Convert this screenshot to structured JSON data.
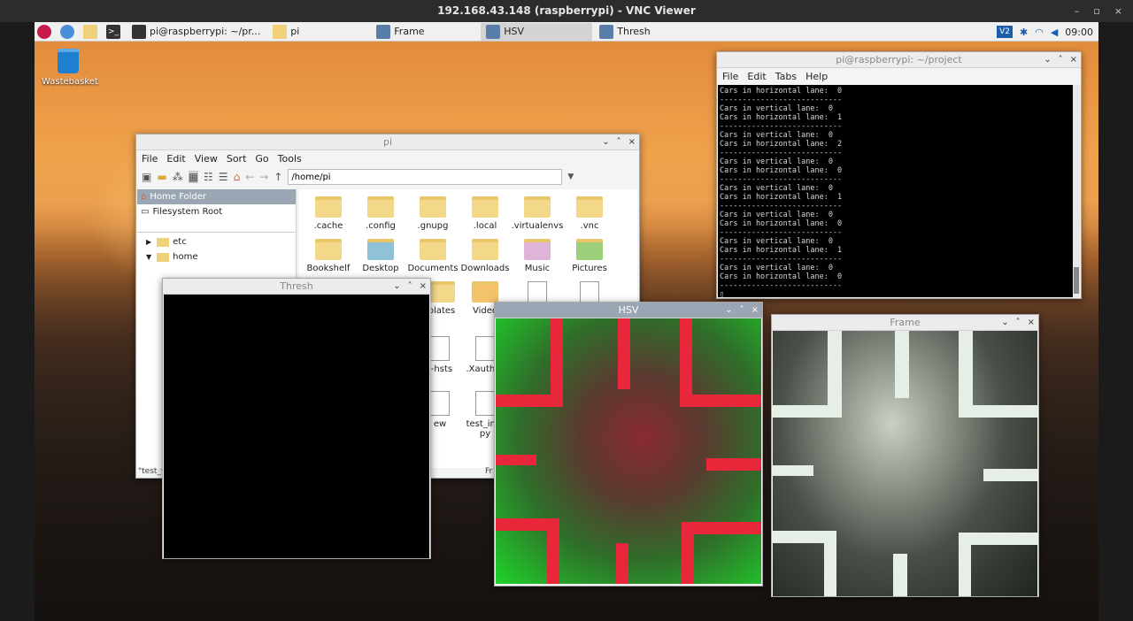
{
  "vnc": {
    "title": "192.168.43.148 (raspberrypi) - VNC Viewer",
    "minimize": "–",
    "restore": "▫",
    "close": "×"
  },
  "panel": {
    "tasks": [
      {
        "label": "pi@raspberrypi: ~/pr..."
      },
      {
        "label": "pi"
      },
      {
        "label": "Frame"
      },
      {
        "label": "HSV"
      },
      {
        "label": "Thresh"
      }
    ],
    "clock": "09:00"
  },
  "desktop": {
    "wastebasket": "Wastebasket"
  },
  "filemanager": {
    "title": "pi",
    "menu": [
      "File",
      "Edit",
      "View",
      "Sort",
      "Go",
      "Tools"
    ],
    "path": "/home/pi",
    "sidebar": [
      "Home Folder",
      "Filesystem Root"
    ],
    "tree": [
      "etc",
      "home"
    ],
    "items": [
      ".cache",
      ".config",
      ".gnupg",
      ".local",
      ".virtualenvs",
      ".vnc",
      "Bookshelf",
      "Desktop",
      "Documents",
      "Downloads",
      "Music",
      "Pictures",
      "plates",
      "Video",
      "t-hsts",
      ".Xauthor",
      "ew",
      "test_ima",
      "py"
    ],
    "status_left": "\"test_v",
    "status_right": "Fr"
  },
  "terminal": {
    "title": "pi@raspberrypi: ~/project",
    "menu": [
      "File",
      "Edit",
      "Tabs",
      "Help"
    ],
    "lines": [
      "Cars in horizontal lane:  0",
      "---------------------------",
      "Cars in vertical lane:  0",
      "Cars in horizontal lane:  1",
      "---------------------------",
      "Cars in vertical lane:  0",
      "Cars in horizontal lane:  2",
      "---------------------------",
      "Cars in vertical lane:  0",
      "Cars in horizontal lane:  0",
      "---------------------------",
      "Cars in vertical lane:  0",
      "Cars in horizontal lane:  1",
      "---------------------------",
      "Cars in vertical lane:  0",
      "Cars in horizontal lane:  0",
      "---------------------------",
      "Cars in vertical lane:  0",
      "Cars in horizontal lane:  1",
      "---------------------------",
      "Cars in vertical lane:  0",
      "Cars in horizontal lane:  0",
      "---------------------------",
      "▯"
    ]
  },
  "windows": {
    "thresh": "Thresh",
    "hsv": "HSV",
    "frame": "Frame"
  },
  "colors": {
    "hsv_green": "#1fd42a",
    "hsv_red": "#e8283a",
    "frame_line": "#e6efe6"
  }
}
